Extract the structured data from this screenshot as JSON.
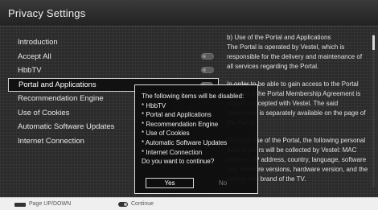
{
  "header": {
    "title": "Privacy Settings"
  },
  "menu": {
    "items": [
      {
        "label": "Introduction",
        "toggle": false
      },
      {
        "label": "Accept All",
        "toggle": true
      },
      {
        "label": "HbbTV",
        "toggle": true
      },
      {
        "label": "Portal and Applications",
        "toggle": true,
        "selected": true
      },
      {
        "label": "Recommendation Engine",
        "toggle": false
      },
      {
        "label": "Use of Cookies",
        "toggle": false
      },
      {
        "label": "Automatic Software Updates",
        "toggle": false
      },
      {
        "label": "Internet Connection",
        "toggle": false
      }
    ]
  },
  "info": {
    "p1": "b) Use of the Portal and Applications",
    "p1b": "The Portal is operated by Vestel, which is responsible for the delivery and maintenance of all services regarding the Portal.",
    "p2": "In order to be able to gain access to the Portal and use it the Portal Membership Agreement is signed / accepted with Vestel. The said agreement is separately available on the page of the Portal.",
    "p3": "Through use of the Portal, the following personal data of yours will be collected by Vestel: MAC address, IP address, country, language, software and firmware versions, hardware version, and the source and brand of the TV."
  },
  "dialog": {
    "heading": "The following items will be disabled:",
    "items": [
      "* HbbTV",
      "* Portal and Applications",
      "* Recommendation Engine",
      "* Use of Cookies",
      "* Automatic Software Updates",
      "* Internet Connection"
    ],
    "question": "Do you want to continue?",
    "yes_label": "Yes",
    "no_label": "No"
  },
  "footer": {
    "page_label": "Page UP/DOWN",
    "continue_label": "Continue"
  },
  "colors": {
    "background": "#2b2b2b",
    "footer": "#efefef",
    "accent": "#ffffff"
  }
}
